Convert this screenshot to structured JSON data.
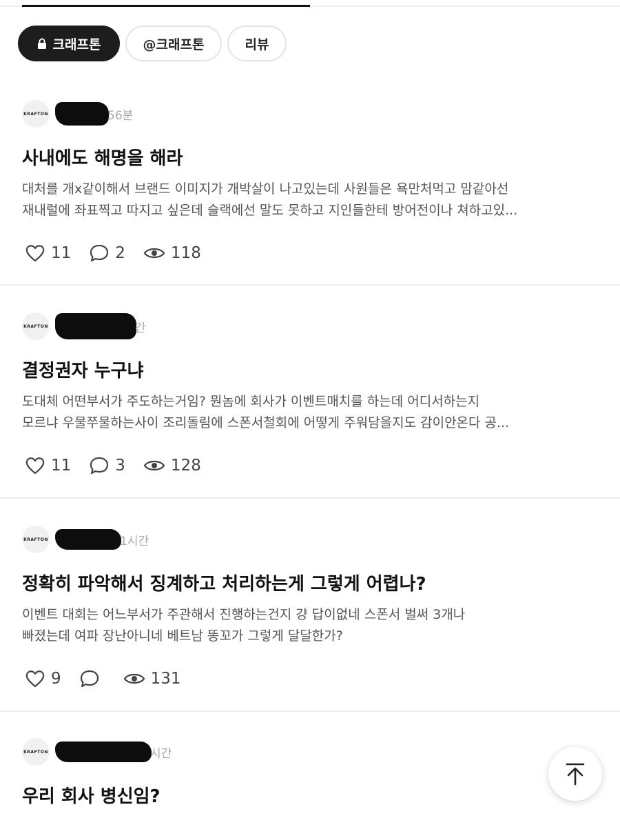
{
  "tabs": {
    "chips": [
      {
        "label": "크래프톤",
        "active": true,
        "icon": "lock-icon"
      },
      {
        "label": "@크래프톤",
        "active": false
      },
      {
        "label": "리뷰",
        "active": false
      }
    ]
  },
  "posts": [
    {
      "avatar": "KRAFTON",
      "time": "56분",
      "title": "사내에도 해명을 해라",
      "body_line1": "대처를 개x같이해서 브랜드 이미지가 개박살이 나고있는데 사원들은 욕만처먹고 맘같아선",
      "body_line2": "재내럴에 좌표찍고 따지고 싶은데 슬랙에선 말도 못하고 지인들한테 방어전이나 쳐하고있...",
      "likes": "11",
      "comments": "2",
      "views": "118"
    },
    {
      "avatar": "KRAFTON",
      "time": "간",
      "title": "결정권자 누구냐",
      "body_line1": "도대체 어떤부서가 주도하는거임? 뭔놈에 회사가 이벤트매치를 하는데 어디서하는지",
      "body_line2": "모르냐  우물쭈물하는사이 조리돌림에 스폰서철회에 어떻게 주워담을지도 감이안온다 공...",
      "likes": "11",
      "comments": "3",
      "views": "128"
    },
    {
      "avatar": "KRAFTON",
      "time": "1시간",
      "title": "정확히 파악해서 징계하고 처리하는게 그렇게 어렵나?",
      "body_line1": "이벤트 대회는 어느부서가 주관해서 진행하는건지  걍 답이없네 스폰서 벌써 3개나",
      "body_line2": "빠졌는데  여파 장난아니네 베트남 똥꼬가 그렇게 달달한가?",
      "likes": "9",
      "comments": "",
      "views": "131"
    },
    {
      "avatar": "KRAFTON",
      "time": "시간",
      "title": "우리 회사 병신임?"
    }
  ],
  "fab": {
    "icon": "scroll-to-top-icon"
  }
}
